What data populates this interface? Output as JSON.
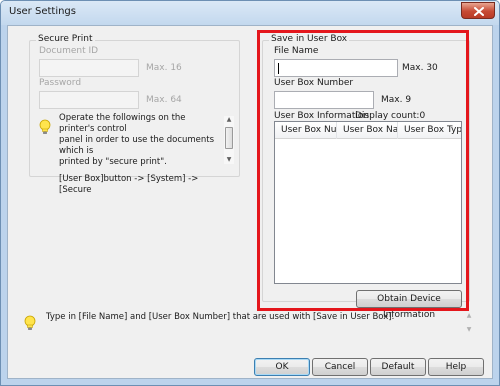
{
  "window": {
    "title": "User Settings"
  },
  "secure_print": {
    "group_label": "Secure Print",
    "document_id_label": "Document ID",
    "document_id_value": "",
    "document_id_max": "Max. 16",
    "password_label": "Password",
    "password_value": "",
    "password_max": "Max. 64",
    "info_line1": "Operate the followings on the printer's control",
    "info_line2": "panel in order to use the documents which is",
    "info_line3": "printed by \"secure print\".",
    "info_line4": "[User Box]button -> [System] -> [Secure"
  },
  "save_in_user_box": {
    "group_label": "Save in User Box",
    "file_name_label": "File Name",
    "file_name_value": "",
    "file_name_max": "Max. 30",
    "box_number_label": "User Box Number",
    "box_number_value": "",
    "box_number_max": "Max. 9",
    "info_label": "User Box Information",
    "display_count": "Display count:0",
    "columns": [
      "User Box Nu...",
      "User Box Name",
      "User Box Type"
    ],
    "obtain_button": "Obtain Device Information"
  },
  "hint": {
    "text": "Type in [File Name] and [User Box Number] that are used with [Save in User Box]."
  },
  "buttons": {
    "ok": "OK",
    "cancel": "Cancel",
    "default": "Default",
    "help": "Help"
  },
  "colors": {
    "highlight": "#e4161c",
    "title_bar": "#c3d8ee",
    "dialog_bg": "#f0f0f0",
    "close_button": "#c74a34"
  }
}
